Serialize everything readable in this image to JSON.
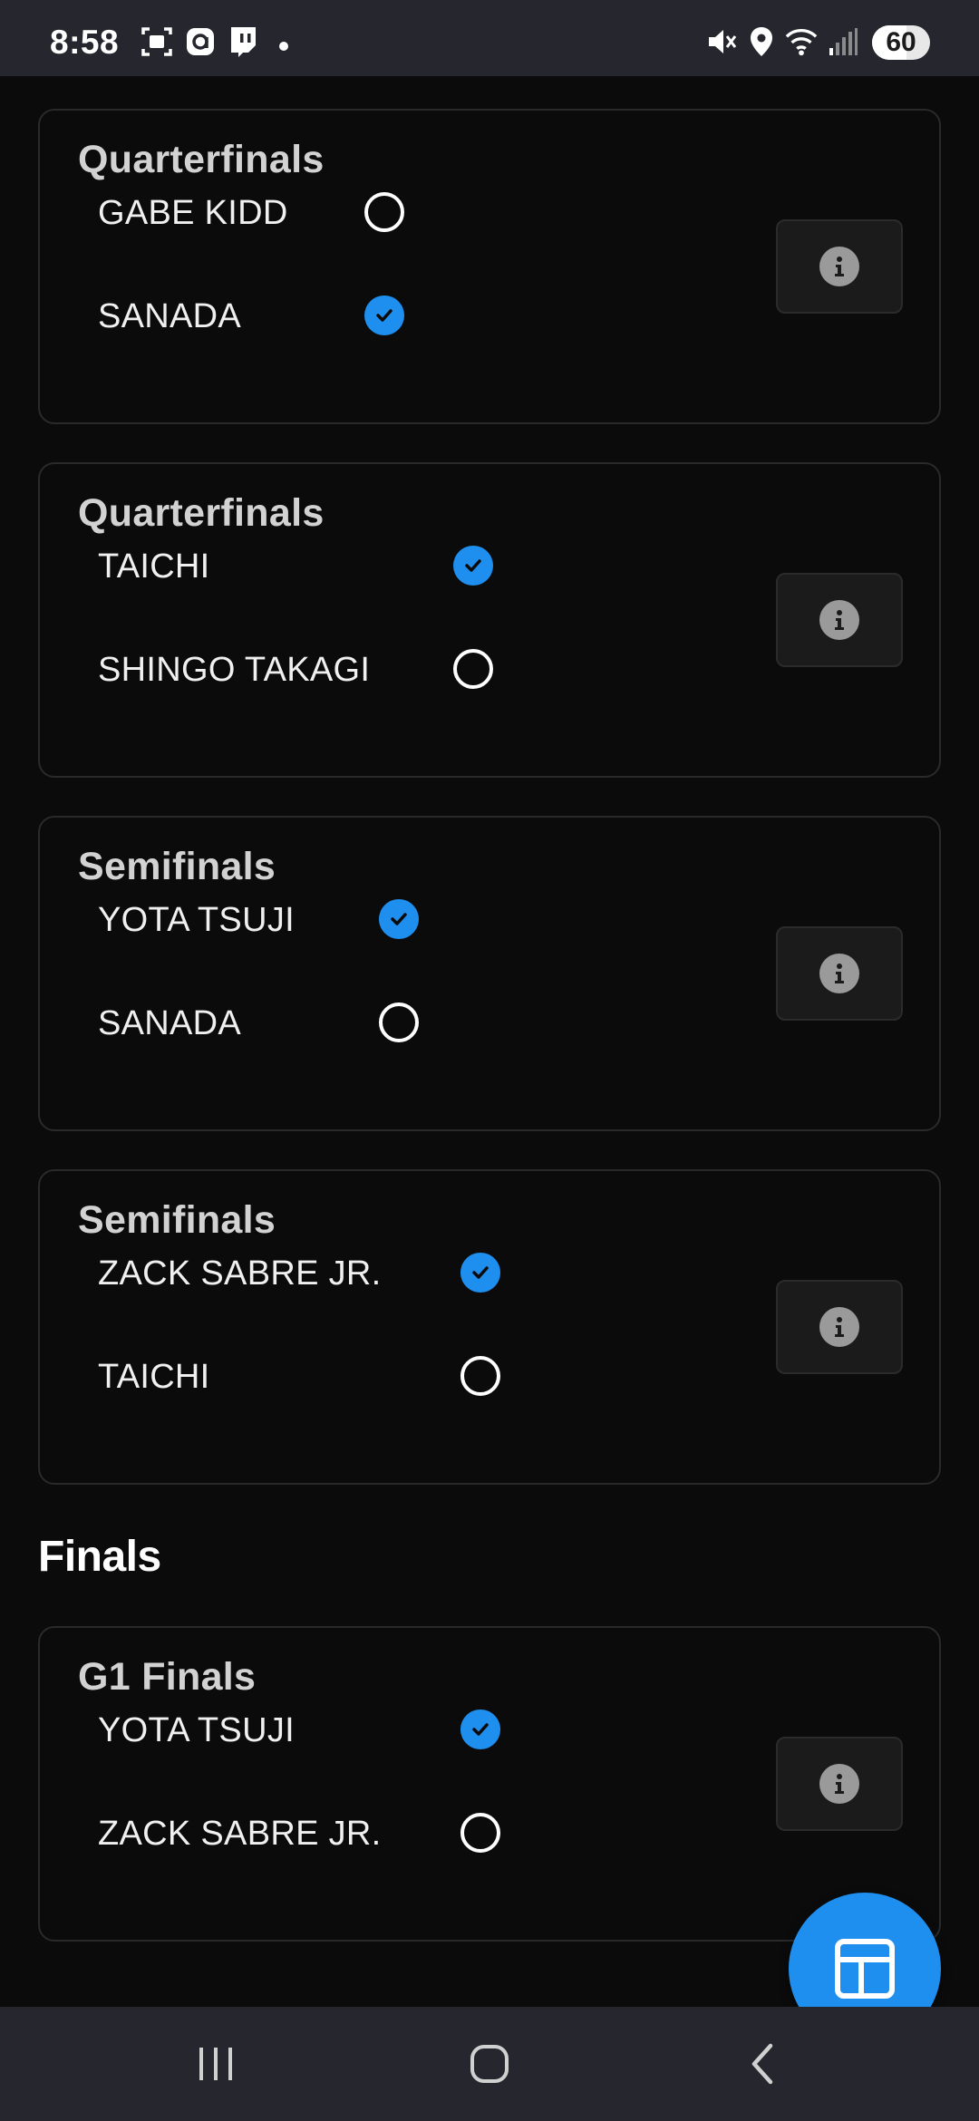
{
  "status_bar": {
    "time": "8:58",
    "battery": "60",
    "icons": [
      "screenshot-icon",
      "app-a-icon",
      "twitch-icon",
      "notification-dot",
      "mute-icon",
      "location-icon",
      "wifi-icon",
      "signal-icon",
      "battery-icon"
    ]
  },
  "matches": [
    {
      "round": "Quarterfinals",
      "competitors": [
        {
          "name": "GABE KIDD",
          "selected": false
        },
        {
          "name": "SANADA",
          "selected": true
        }
      ]
    },
    {
      "round": "Quarterfinals",
      "competitors": [
        {
          "name": "TAICHI",
          "selected": true
        },
        {
          "name": "SHINGO TAKAGI",
          "selected": false
        }
      ]
    },
    {
      "round": "Semifinals",
      "competitors": [
        {
          "name": "YOTA TSUJI",
          "selected": true
        },
        {
          "name": "SANADA",
          "selected": false
        }
      ]
    },
    {
      "round": "Semifinals",
      "competitors": [
        {
          "name": "ZACK SABRE JR.",
          "selected": true
        },
        {
          "name": "TAICHI",
          "selected": false
        }
      ]
    }
  ],
  "finals_section": {
    "heading": "Finals",
    "match": {
      "round": "G1 Finals",
      "competitors": [
        {
          "name": "YOTA TSUJI",
          "selected": true
        },
        {
          "name": "ZACK SABRE JR.",
          "selected": false
        }
      ]
    }
  },
  "colors": {
    "accent": "#1e8fef",
    "background": "#0b0b0c",
    "card_border": "#2a2a2c",
    "system_bars": "#26262e"
  },
  "icons": {
    "info": "info-icon",
    "fab": "bracket-grid-icon",
    "nav": [
      "recents-icon",
      "home-icon",
      "back-icon"
    ]
  }
}
